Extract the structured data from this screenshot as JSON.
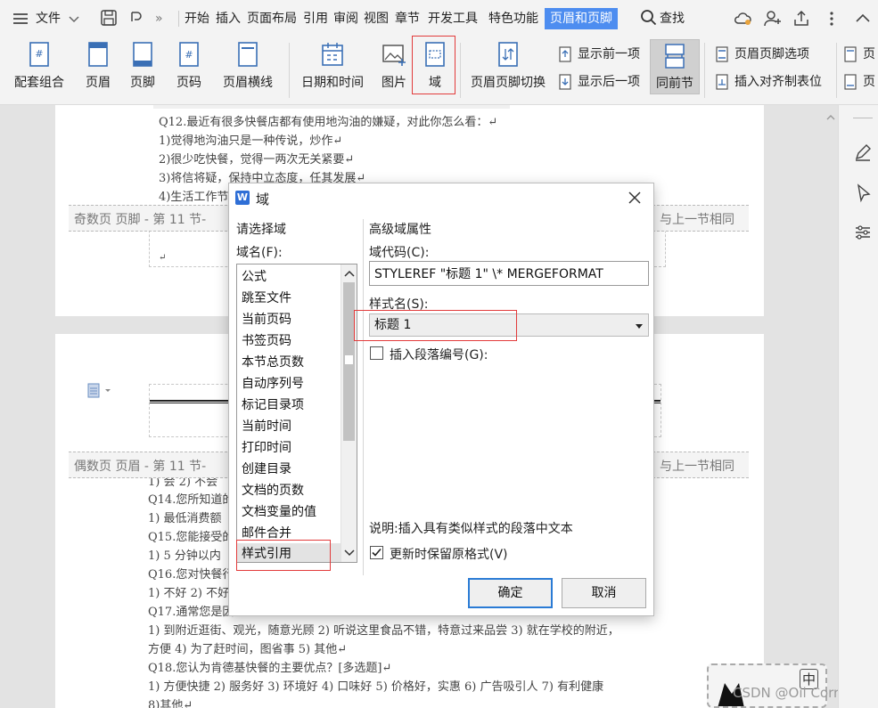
{
  "menubar": {
    "file_label": "文件",
    "tabs": [
      "开始",
      "插入",
      "页面布局",
      "引用",
      "审阅",
      "视图",
      "章节",
      "开发工具",
      "特色功能",
      "页眉和页脚"
    ],
    "more_glyph": "»",
    "search_label": "查找"
  },
  "ribbon": {
    "buttons": {
      "match_combo": "配套组合",
      "header": "页眉",
      "footer": "页脚",
      "page_number": "页码",
      "header_line": "页眉横线",
      "date_time": "日期和时间",
      "picture": "图片",
      "field": "域",
      "switch_hf": "页眉页脚切换",
      "same_as_prev": "同前节"
    },
    "small": {
      "show_prev": "显示前一项",
      "show_next": "显示后一项",
      "hf_options": "页眉页脚选项",
      "insert_align_tab": "插入对齐制表位"
    },
    "clipped_right": [
      "页",
      "页"
    ]
  },
  "document": {
    "page1_lines": [
      "Q12.最近有很多快餐店都有使用地沟油的嫌疑，对此你怎么看：↵",
      "1)觉得地沟油只是一种传说，炒作↵",
      "2)很少吃快餐，觉得一两次无关紧要↵",
      "3)将信将疑，保持中立态度，任其发展↵",
      "4)生活工作节"
    ],
    "odd_footer_label": "奇数页 页脚 - 第 11 节-",
    "same_as_prev_footer": "与上一节相同",
    "even_header_label": "偶数页 页眉 - 第 11 节-",
    "same_as_prev_header": "与上一节相同",
    "page2_lines": [
      "1) 会 2) 不会",
      "Q14.您所知道的",
      "1) 最低消费额",
      "Q15.您能接受的",
      "1) 5 分钟以内",
      "Q16.您对快餐行",
      "1) 不好 2) 不好",
      "Q17.通常您是因",
      "1) 到附近逛街、观光，随意光顾 2) 听说这里食品不错，特意过来品尝 3) 就在学校的附近，",
      "方便 4) 为了赶时间，图省事 5) 其他↵",
      "Q18.您认为肯德基快餐的主要优点？[多选题]↵",
      "1) 方便快捷 2) 服务好 3) 环境好 4) 口味好 5) 价格好，实惠 6) 广告吸引人 7) 有利健康",
      "8)其他↵"
    ],
    "paragraph_mark": "↵"
  },
  "dialog": {
    "title": "域",
    "left_header": "请选择域",
    "field_name_label": "域名(F):",
    "fields": [
      "公式",
      "跳至文件",
      "当前页码",
      "书签页码",
      "本节总页数",
      "自动序列号",
      "标记目录项",
      "当前时间",
      "打印时间",
      "创建目录",
      "文档的页数",
      "文档变量的值",
      "邮件合并",
      "样式引用"
    ],
    "selected_field": "样式引用",
    "right_header": "高级域属性",
    "field_code_label": "域代码(C):",
    "field_code_value": "STYLEREF \"标题 1\" \\* MERGEFORMAT",
    "style_name_label": "样式名(S):",
    "style_name_value": "标题 1",
    "insert_para_number_label": "插入段落编号(G):",
    "insert_para_number_checked": false,
    "description": "说明:插入具有类似样式的段落中文本",
    "keep_format_label": "更新时保留原格式(V)",
    "keep_format_checked": true,
    "ok_label": "确定",
    "cancel_label": "取消"
  },
  "ime": {
    "label": "中"
  },
  "watermark": "CSDN @Oil Correct",
  "colors": {
    "accent": "#4d8df0",
    "highlight_box": "#e23b3b",
    "ok_border": "#2a7bd5"
  }
}
